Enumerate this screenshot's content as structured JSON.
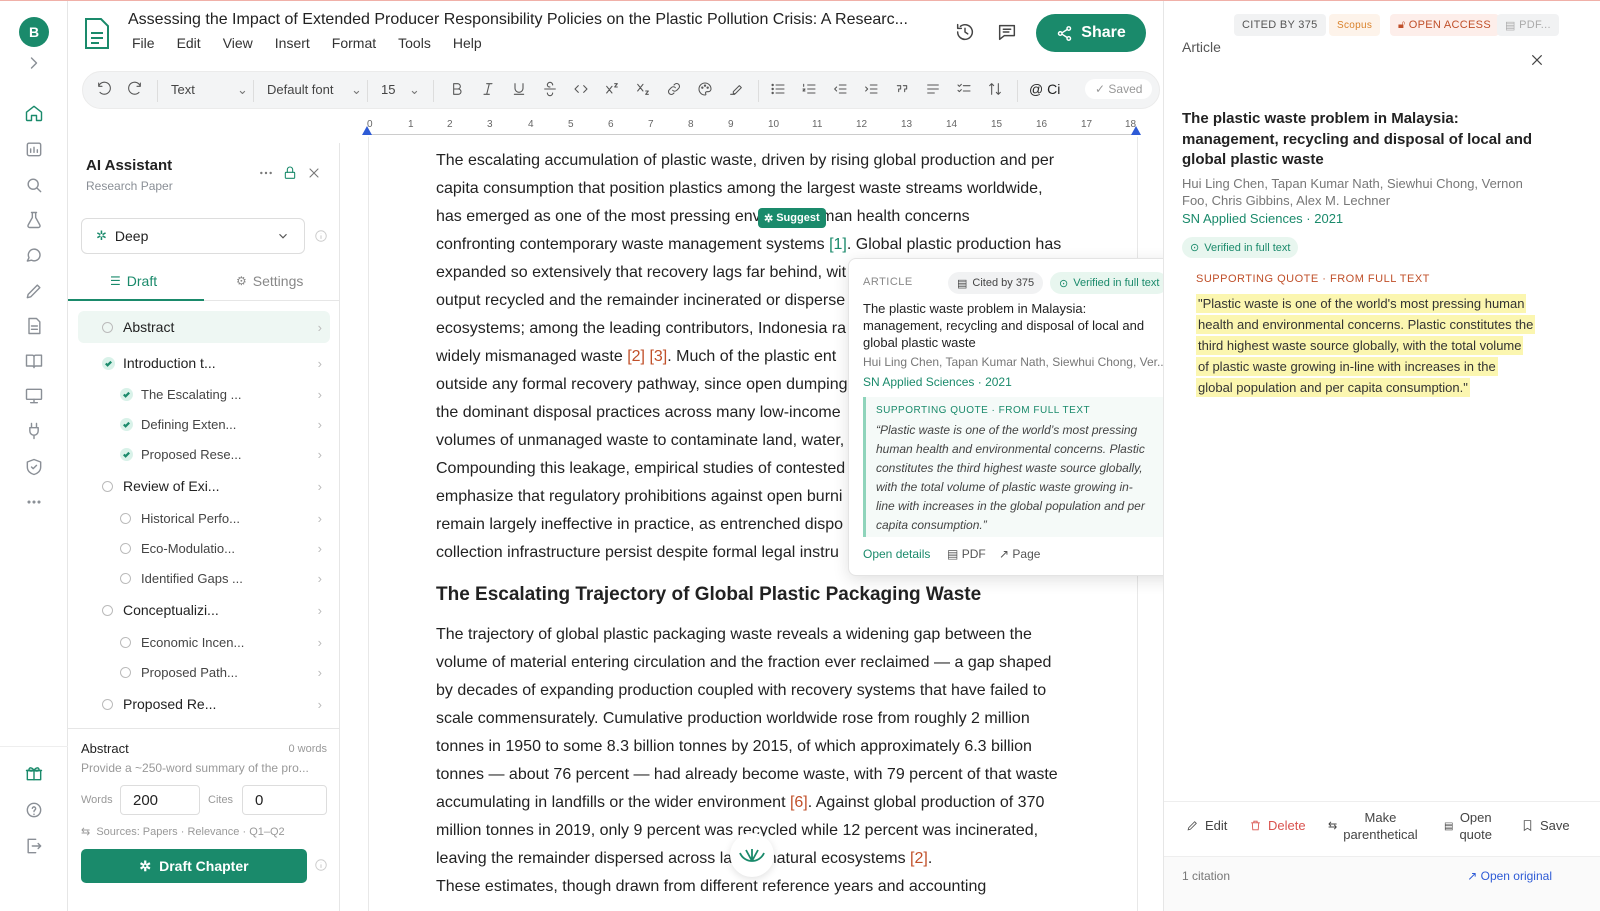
{
  "rail": {
    "avatar_letter": "B",
    "icons": [
      "chevron-right-icon",
      "home-icon",
      "folder-icon",
      "search-icon",
      "flask-icon",
      "chat-icon",
      "pencil-icon",
      "document-icon",
      "book-icon",
      "presentation-icon",
      "plug-icon",
      "shield-icon",
      "more-icon",
      "gift-icon",
      "help-icon",
      "logout-icon"
    ]
  },
  "header": {
    "title": "Assessing the Impact of Extended Producer Responsibility Policies on the Plastic Pollution Crisis: A Researc...",
    "menu": [
      "File",
      "Edit",
      "View",
      "Insert",
      "Format",
      "Tools",
      "Help"
    ],
    "share_label": "Share"
  },
  "format_bar": {
    "style": "Text",
    "font": "Default font",
    "size": "15",
    "cite_label": "Ci",
    "saved_label": "Saved"
  },
  "ruler": {
    "ticks": [
      "0",
      "1",
      "2",
      "3",
      "4",
      "5",
      "6",
      "7",
      "8",
      "9",
      "10",
      "11",
      "12",
      "13",
      "14",
      "15",
      "16",
      "17",
      "18"
    ]
  },
  "ai_panel": {
    "title": "AI Assistant",
    "subtitle": "Research Paper",
    "mode": "Deep",
    "tabs": [
      "Draft",
      "Settings"
    ],
    "outline": [
      {
        "label": "Abstract",
        "level": 0,
        "status": "pending",
        "active": true
      },
      {
        "label": "Introduction t...",
        "level": 0,
        "status": "done"
      },
      {
        "label": "The Escalating ...",
        "level": 1,
        "status": "done"
      },
      {
        "label": "Defining Exten...",
        "level": 1,
        "status": "done"
      },
      {
        "label": "Proposed Rese...",
        "level": 1,
        "status": "done"
      },
      {
        "label": "Review of Exi...",
        "level": 0,
        "status": "pending"
      },
      {
        "label": "Historical Perfo...",
        "level": 1,
        "status": "pending"
      },
      {
        "label": "Eco-Modulatio...",
        "level": 1,
        "status": "pending"
      },
      {
        "label": "Identified Gaps ...",
        "level": 1,
        "status": "pending"
      },
      {
        "label": "Conceptualizi...",
        "level": 0,
        "status": "pending"
      },
      {
        "label": "Economic Incen...",
        "level": 1,
        "status": "pending"
      },
      {
        "label": "Proposed Path...",
        "level": 1,
        "status": "pending"
      },
      {
        "label": "Proposed Re...",
        "level": 0,
        "status": "pending"
      }
    ],
    "section_title": "Abstract",
    "word_count": "0 words",
    "section_hint": "Provide a ~250-word summary of the pro...",
    "words_label": "Words",
    "words_value": "200",
    "cites_label": "Cites",
    "cites_value": "0",
    "sources": "Sources: Papers · Relevance · Q1–Q2",
    "draft_button": "Draft Chapter"
  },
  "document": {
    "p1": [
      {
        "t": "The escalating accumulation of plastic waste, driven by rising global production and per"
      },
      {
        "t": "capita consumption that position plastics among the largest waste streams worldwide,"
      },
      {
        "t": "has emerged as one of the most pressing envi",
        "t2": "l and human health concerns"
      },
      {
        "t": "confronting contemporary waste management systems ",
        "c": "[1]",
        "t2": ". Global plastic production has"
      },
      {
        "t": "expanded so extensively that recovery lags far behind, wit"
      },
      {
        "t": "output recycled and the remainder incinerated or disperse"
      },
      {
        "t": "ecosystems; among the leading contributors, Indonesia ra"
      },
      {
        "t": "widely mismanaged waste ",
        "c": "[2] [3]",
        "t2": ". Much of the plastic ent"
      },
      {
        "t": "outside any formal recovery pathway, since open dumping"
      },
      {
        "t": "the dominant disposal practices across many low-income"
      },
      {
        "t": "volumes of unmanaged waste to contaminate land, water,"
      },
      {
        "t": "Compounding this leakage, empirical studies of contested"
      },
      {
        "t": "emphasize that regulatory prohibitions against open burni"
      },
      {
        "t": "remain largely ineffective in practice, as entrenched dispo"
      },
      {
        "t": "collection infrastructure persist despite formal legal instru"
      }
    ],
    "heading": "The Escalating Trajectory of Global Plastic Packaging Waste",
    "p2": [
      {
        "t": "The trajectory of global plastic packaging waste reveals a widening gap between the"
      },
      {
        "t": "volume of material entering circulation and the fraction ever reclaimed — a gap shaped"
      },
      {
        "t": "by decades of expanding production coupled with recovery systems that have failed to"
      },
      {
        "t": "scale commensurately. Cumulative production worldwide rose from roughly 2 million"
      },
      {
        "t": "tonnes in 1950 to some 8.3 billion tonnes by 2015, of which approximately 6.3 billion"
      },
      {
        "t": "tonnes — about 76 percent — had already become waste, with 79 percent of that waste"
      },
      {
        "t": "accumulating in landfills or the wider environment ",
        "c": "[6]",
        "t2": ". Against global production of 370"
      },
      {
        "t": "million tonnes in 2019, only 9 percent was recycled while 12 percent was incinerated,"
      },
      {
        "t": "leaving the remainder dispersed across la",
        "t2": "  and natural ecosystems ",
        "c2": "[2]",
        "t3": "."
      },
      {
        "t": "These estimates, though drawn from different reference years and accounting"
      }
    ],
    "suggest_label": "Suggest"
  },
  "popover": {
    "kind": "ARTICLE",
    "cited": "Cited by 375",
    "verified": "Verified in full text",
    "title_lines": [
      "The plastic waste problem in Malaysia:",
      "management, recycling and disposal of local and",
      "global plastic waste"
    ],
    "authors": "Hui Ling Chen, Tapan Kumar Nath, Siewhui Chong, Ver...",
    "venue": "SN Applied Sciences · 2021",
    "quote_label": "SUPPORTING QUOTE · FROM FULL TEXT",
    "quote_lines": [
      "“Plastic waste is one of the world’s most pressing",
      "human health and environmental concerns. Plastic",
      "constitutes the third highest waste source globally,",
      "with the total volume of plastic waste growing in-",
      "line with increases in the global population and per",
      "capita consumption.”"
    ],
    "open_details": "Open details",
    "pdf": "PDF",
    "page": "Page"
  },
  "right_panel": {
    "badges": [
      "CITED BY 375",
      "Scopus",
      "OPEN ACCESS",
      "PDF..."
    ],
    "label": "Article",
    "title_lines": [
      "The plastic waste problem in Malaysia:",
      "management, recycling and disposal of local and",
      "global plastic waste"
    ],
    "authors_lines": [
      "Hui Ling Chen, Tapan Kumar Nath, Siewhui Chong, Vernon",
      "Foo, Chris Gibbins, Alex M. Lechner"
    ],
    "venue": "SN Applied Sciences · 2021",
    "verified": "Verified in full text",
    "quote_label": "SUPPORTING QUOTE · FROM FULL TEXT",
    "quote_lines": [
      "\"Plastic waste is one of the world's most pressing human",
      "health and environmental concerns. Plastic constitutes the",
      "third highest waste source globally, with the total volume",
      "of plastic waste growing in-line with increases in the",
      "global population and per capita consumption.\""
    ],
    "actions": {
      "edit": "Edit",
      "delete": "Delete",
      "make1": "Make",
      "make2": "parenthetical",
      "open1": "Open",
      "open2": "quote",
      "save": "Save"
    },
    "citation_count": "1 citation",
    "open_original": "Open original"
  },
  "colors": {
    "accent": "#1a8a6b",
    "cite": "#c0502a",
    "highlight": "#fbf6b0",
    "delete": "#d9534f"
  }
}
